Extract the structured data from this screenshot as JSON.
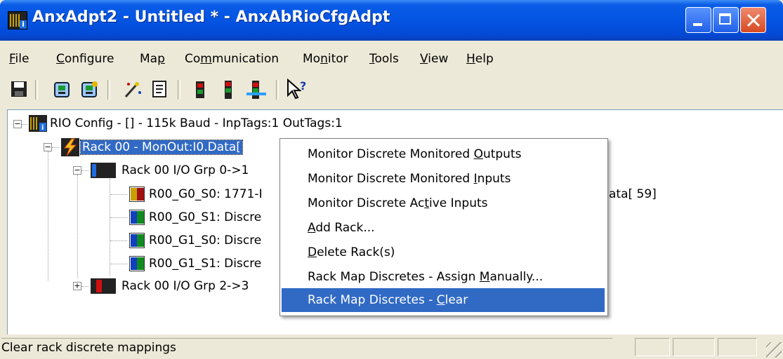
{
  "window": {
    "title": "AnxAdpt2 - Untitled * - AnxAbRioCfgAdpt"
  },
  "menubar": {
    "items": [
      {
        "pre": "",
        "ul": "F",
        "post": "ile"
      },
      {
        "pre": "",
        "ul": "C",
        "post": "onfigure"
      },
      {
        "pre": "Ma",
        "ul": "p",
        "post": ""
      },
      {
        "pre": "Co",
        "ul": "m",
        "post": "munication"
      },
      {
        "pre": "Mo",
        "ul": "n",
        "post": "itor"
      },
      {
        "pre": "",
        "ul": "T",
        "post": "ools"
      },
      {
        "pre": "",
        "ul": "V",
        "post": "iew"
      },
      {
        "pre": "",
        "ul": "H",
        "post": "elp"
      }
    ]
  },
  "toolbar": {
    "icons": [
      "save-icon",
      "load-config-icon",
      "download-config-icon",
      "wizard-icon",
      "report-icon",
      "monitor-red-icon",
      "monitor-green-icon",
      "monitor-blue-icon",
      "context-help-icon"
    ]
  },
  "tree": {
    "root": "RIO Config - [] - 115k Baud - InpTags:1 OutTags:1",
    "rack": "Rack 00 - MonOut:I0.Data[",
    "grp1": "Rack 00 I/O Grp 0->1",
    "slots": [
      {
        "label": "R00_G0_S0: 1771-I",
        "color_a": "#c8a000",
        "color_b": "#a01010"
      },
      {
        "label": "R00_G0_S1: Discre",
        "color_a": "#1040c0",
        "color_b": "#108a20"
      },
      {
        "label": "R00_G1_S0: Discre",
        "color_a": "#1040c0",
        "color_b": "#108a20"
      },
      {
        "label": "R00_G1_S1: Discre",
        "color_a": "#1040c0",
        "color_b": "#108a20"
      }
    ],
    "slot0_tail": "ata[ 59]",
    "grp2": "Rack 00 I/O Grp 2->3"
  },
  "context_menu": {
    "items": [
      {
        "pre": "Monitor Discrete Monitored ",
        "ul": "O",
        "post": "utputs"
      },
      {
        "pre": "Monitor Discrete Monitored ",
        "ul": "I",
        "post": "nputs"
      },
      {
        "pre": "Monitor Discrete Ac",
        "ul": "t",
        "post": "ive Inputs"
      },
      {
        "pre": "",
        "ul": "A",
        "post": "dd Rack..."
      },
      {
        "pre": "",
        "ul": "D",
        "post": "elete Rack(s)"
      },
      {
        "pre": "Rack Map Discretes - Assign ",
        "ul": "M",
        "post": "anually..."
      },
      {
        "pre": "Rack Map Discretes - ",
        "ul": "C",
        "post": "lear"
      }
    ]
  },
  "statusbar": {
    "text": "Clear rack discrete mappings"
  },
  "colors": {
    "selection": "#316ac5",
    "titlebar": "#0454e3"
  }
}
